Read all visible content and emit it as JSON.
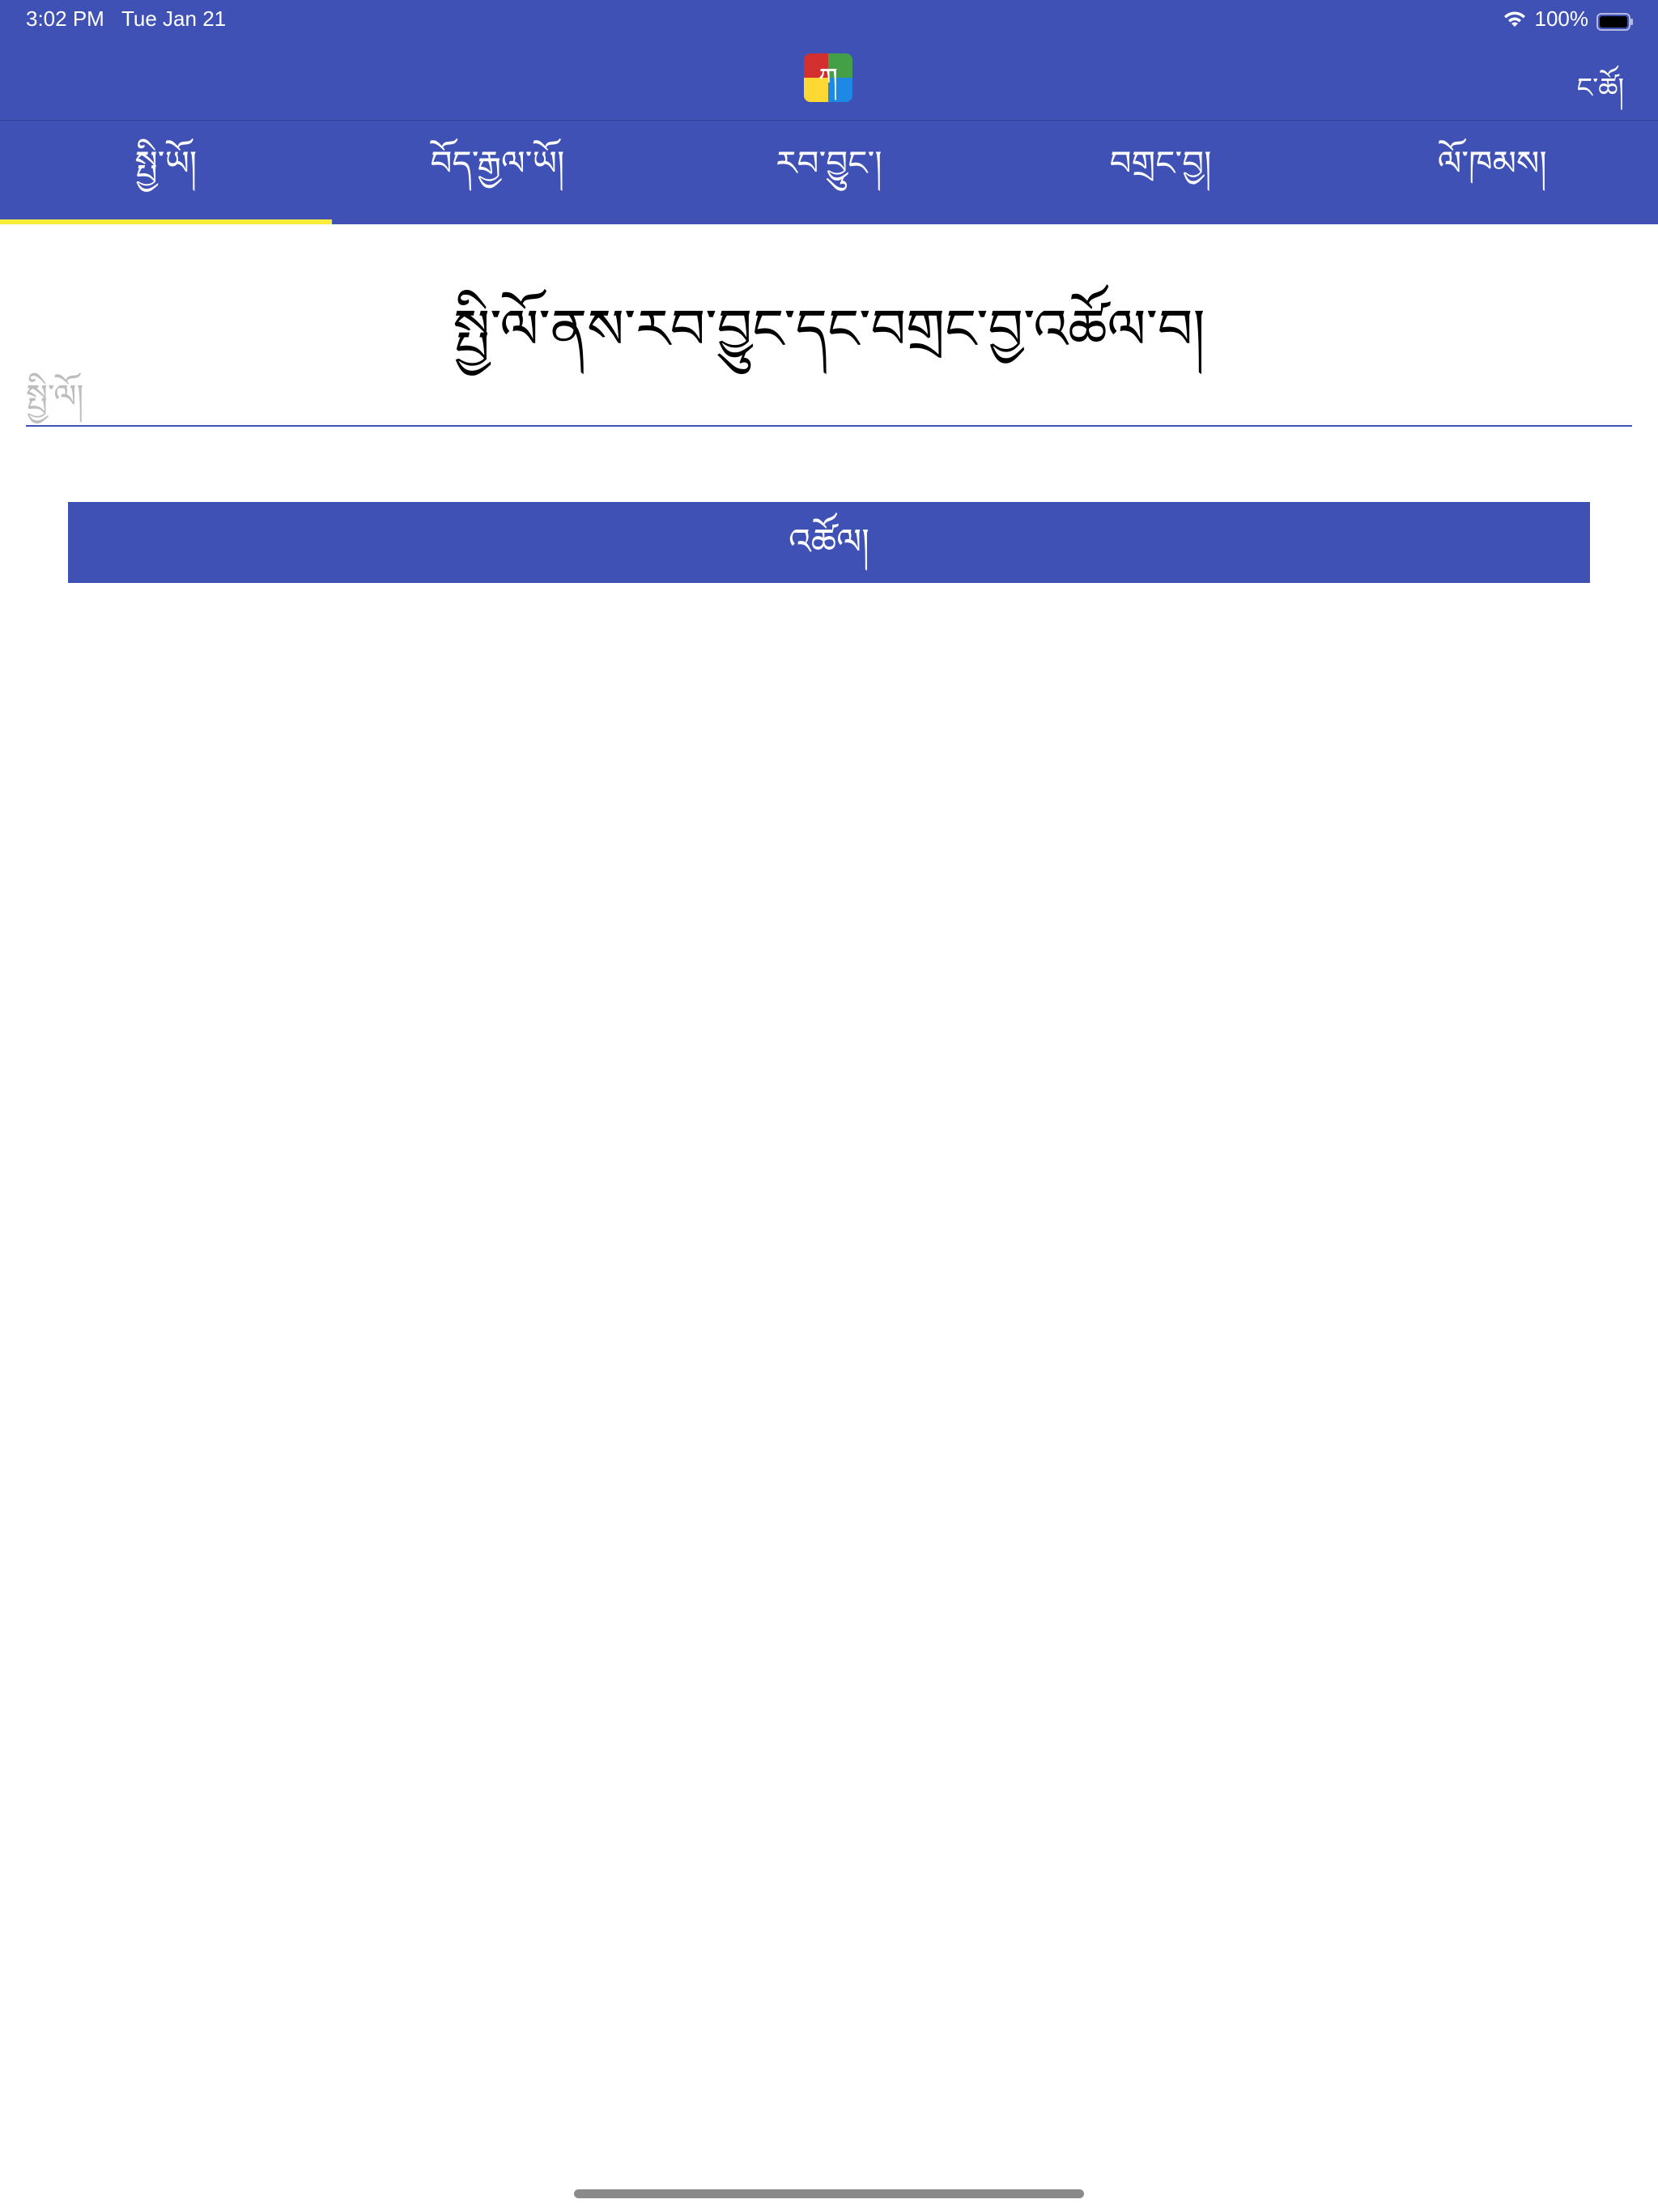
{
  "status_bar": {
    "time": "3:02 PM",
    "date": "Tue Jan 21",
    "battery": "100%"
  },
  "nav_bar": {
    "logo_glyph": "ཀ",
    "right_button": "ང་ཚོ།"
  },
  "tabs": [
    {
      "label": "སྤྱི་ཡོ།",
      "active": true
    },
    {
      "label": "བོད་རྒྱལ་ཡོ།",
      "active": false
    },
    {
      "label": "རབ་བྱུང་།",
      "active": false
    },
    {
      "label": "བགྲང་བྱ།",
      "active": false
    },
    {
      "label": "ལོ་ཁམས།",
      "active": false
    }
  ],
  "main": {
    "title": "སྤྱི་ལོ་ནས་རབ་བྱུང་དང་བགྲང་བྱ་འཚོལ་བ།",
    "input": {
      "value": "",
      "placeholder": "སྤྱི་ལོ།"
    },
    "submit_label": "འཚོལ།"
  },
  "colors": {
    "primary": "#3f51b5",
    "tab_indicator": "#ffeb3b",
    "logo_red": "#d32f2f",
    "logo_green": "#43a047",
    "logo_yellow": "#fdd835",
    "logo_blue": "#1e88e5"
  }
}
